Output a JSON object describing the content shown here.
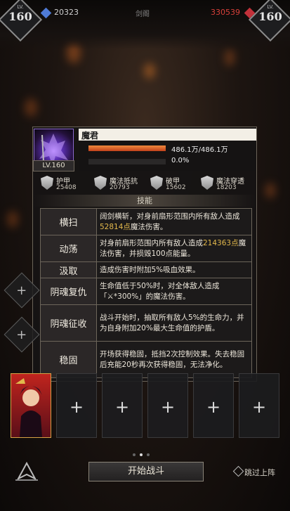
{
  "top_bar": {
    "left": {
      "level_label": "LV.",
      "level": "160",
      "power": "20323"
    },
    "center_label": "剑阁",
    "right": {
      "level_label": "LV.",
      "level": "160",
      "power": "330539"
    }
  },
  "boss": {
    "name": "魔君",
    "level_label": "LV.160",
    "hp_text": "486.1万/486.1万",
    "hp_fraction": 1.0,
    "shield_text": "0.0%",
    "shield_fraction": 0.0
  },
  "stats": [
    {
      "name": "护甲",
      "value": "25408",
      "icon": "armor-icon"
    },
    {
      "name": "魔法抵抗",
      "value": "20793",
      "icon": "magic-resist-icon"
    },
    {
      "name": "破甲",
      "value": "15602",
      "icon": "armor-break-icon"
    },
    {
      "name": "魔法穿透",
      "value": "18203",
      "icon": "magic-penetration-icon"
    }
  ],
  "skills_title": "技能",
  "skills": [
    {
      "name": "横扫",
      "desc_pre": "阔剑横斩，对身前扇形范围内所有敌人造成",
      "desc_hl": "52814点",
      "desc_post": "魔法伤害。"
    },
    {
      "name": "动荡",
      "desc_pre": "对身前扇形范围内所有敌人造成",
      "desc_hl": "214363点",
      "desc_post": "魔法伤害，并损毁100点能量。"
    },
    {
      "name": "汲取",
      "desc_pre": "造成伤害时附加5%吸血效果。",
      "desc_hl": "",
      "desc_post": ""
    },
    {
      "name": "阴魂复仇",
      "desc_pre": "生命值低于50%时，对全体敌人造成「",
      "desc_hl": "⚔*300%",
      "desc_post": "」的魔法伤害。"
    },
    {
      "name": "阴魂征收",
      "desc_pre": "战斗开始时，抽取所有敌人5%的生命力，并为自身附加20%最大生命值的护盾。",
      "desc_hl": "",
      "desc_post": ""
    },
    {
      "name": "稳固",
      "desc_pre": "开场获得稳固，抵挡2次控制效果。失去稳固后充能20秒再次获得稳固，无法净化。",
      "desc_hl": "",
      "desc_post": ""
    }
  ],
  "bottom": {
    "add_symbol": "+",
    "start_button": "开始战斗",
    "skip_label": "跳过上阵"
  },
  "colors": {
    "highlight": "#e3b94c",
    "hp": "#d8562a",
    "panel_border": "#6c655a"
  }
}
